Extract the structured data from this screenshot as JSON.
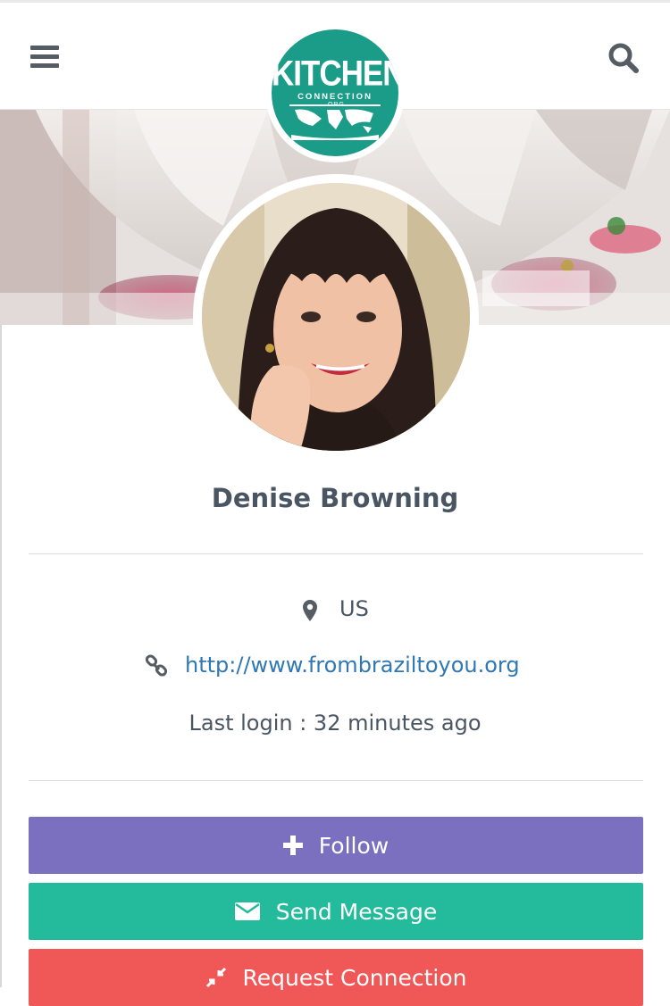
{
  "header": {
    "logo": {
      "title": "KITCHEN",
      "subtitle": "CONNECTION",
      "suffix": ".ORG"
    },
    "menu_icon": "hamburger-icon",
    "search_icon": "search-icon"
  },
  "profile": {
    "name": "Denise Browning",
    "location": "US",
    "website": "http://www.frombraziltoyou.org",
    "last_login": "Last login : 32 minutes ago"
  },
  "actions": {
    "follow": "Follow",
    "send_message": "Send Message",
    "request_connection": "Request Connection"
  },
  "colors": {
    "follow": "#7b6fc0",
    "send_message": "#23bb9c",
    "request_connection": "#f05757",
    "brand_teal": "#1a9c89",
    "link": "#2f77b5"
  }
}
